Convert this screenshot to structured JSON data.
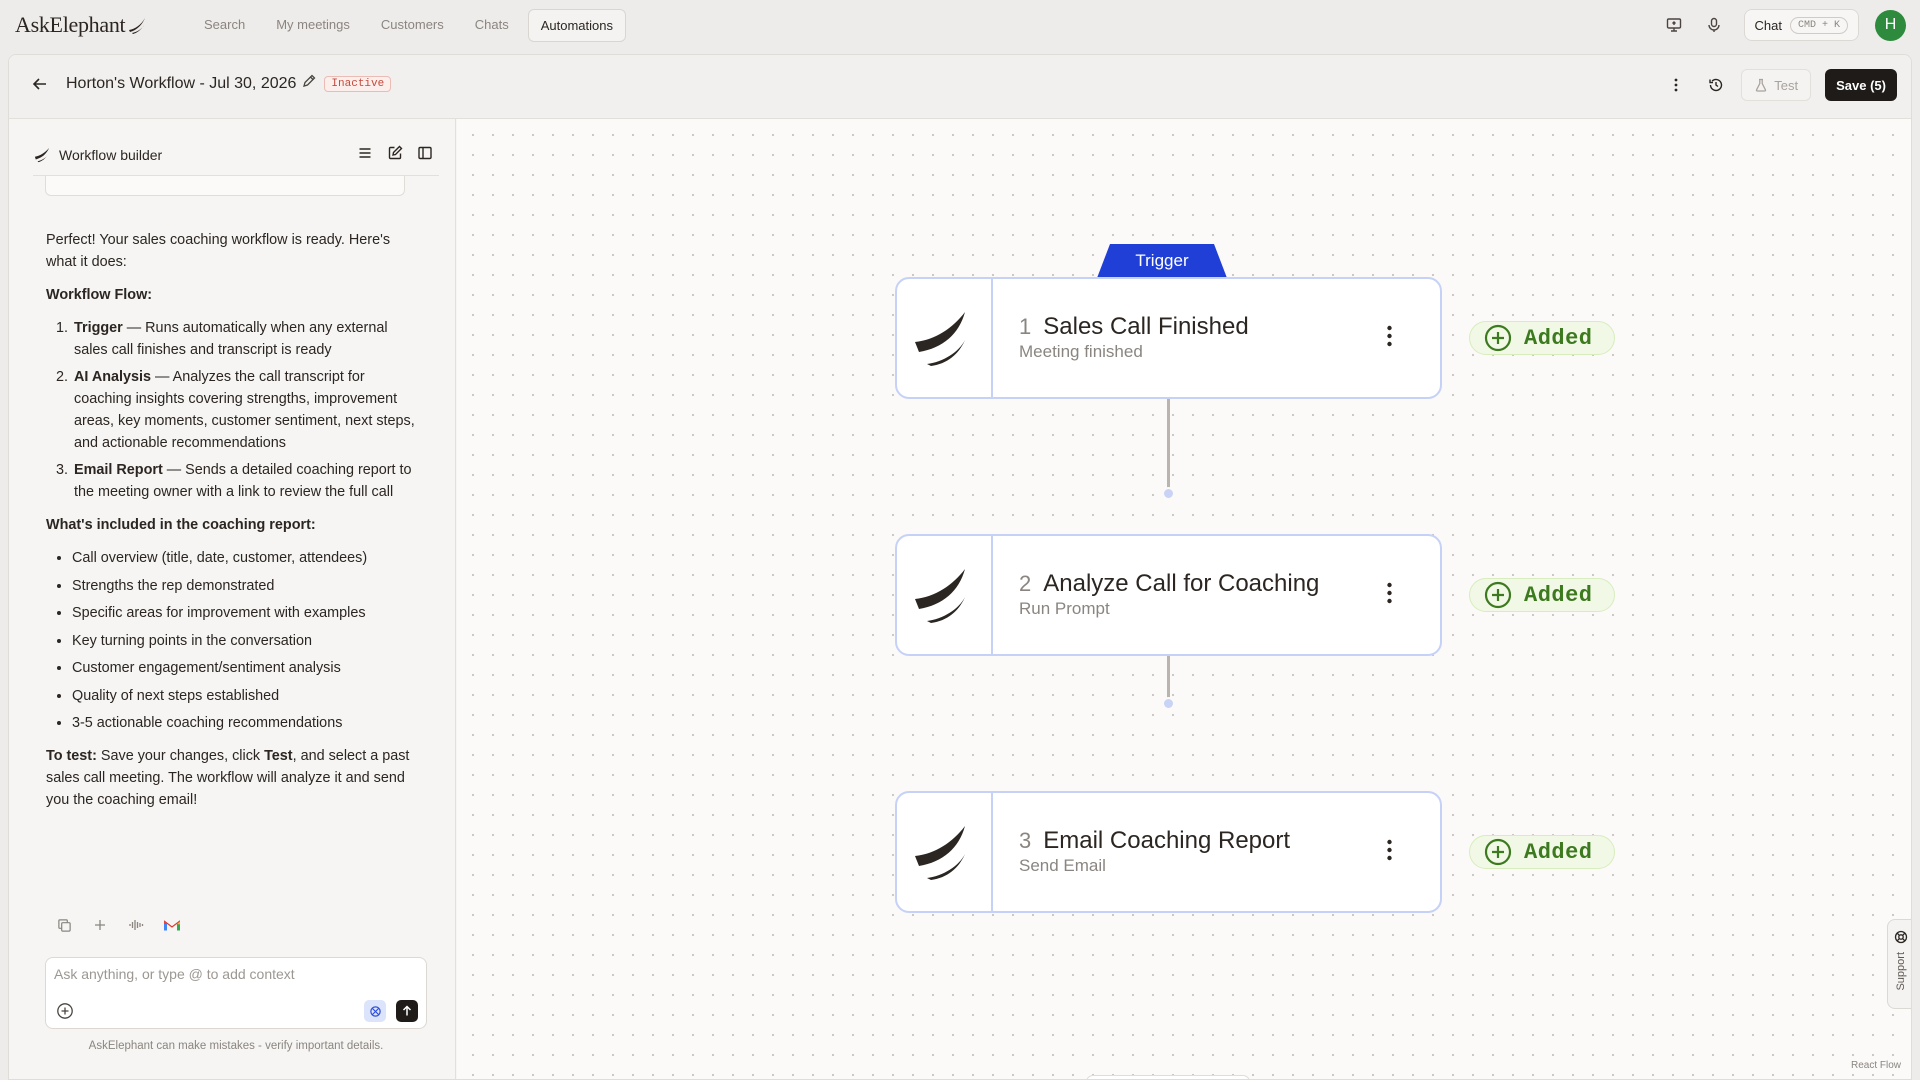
{
  "app": {
    "logo_text": "AskElephant",
    "nav_tabs": [
      {
        "label": "Search"
      },
      {
        "label": "My meetings"
      },
      {
        "label": "Customers"
      },
      {
        "label": "Chats"
      },
      {
        "label": "Automations",
        "active": true
      }
    ],
    "chat_button": {
      "label": "Chat",
      "shortcut": "CMD + K"
    },
    "avatar_initial": "H",
    "avatar_color": "#2e8b3e"
  },
  "header": {
    "title": "Horton's Workflow - Jul 30, 2026",
    "status": "Inactive",
    "test_label": "Test",
    "save_label": "Save (5)"
  },
  "sidebar": {
    "title": "Workflow builder",
    "message": {
      "intro": "Perfect! Your sales coaching workflow is ready. Here's what it does:",
      "flow_heading": "Workflow Flow:",
      "steps": [
        {
          "name": "Trigger",
          "desc": " — Runs automatically when any external sales call finishes and transcript is ready"
        },
        {
          "name": "AI Analysis",
          "desc": " — Analyzes the call transcript for coaching insights covering strengths, improvement areas, key moments, customer sentiment, next steps, and actionable recommendations"
        },
        {
          "name": "Email Report",
          "desc": " — Sends a detailed coaching report to the meeting owner with a link to review the full call"
        }
      ],
      "included_heading": "What's included in the coaching report:",
      "included": [
        "Call overview (title, date, customer, attendees)",
        "Strengths the rep demonstrated",
        "Specific areas for improvement with examples",
        "Key turning points in the conversation",
        "Customer engagement/sentiment analysis",
        "Quality of next steps established",
        "3-5 actionable coaching recommendations"
      ],
      "test_label": "To test:",
      "test_pre": " Save your changes, click ",
      "test_bold": "Test",
      "test_post": ", and select a past sales call meeting. The workflow will analyze it and send you the coaching email!"
    },
    "input_placeholder": "Ask anything, or type @ to add context",
    "disclaimer": "AskElephant can make mistakes - verify important details."
  },
  "canvas": {
    "trigger_label": "Trigger",
    "accent_color": "#1f3fd6",
    "nodes": [
      {
        "num": "1",
        "name": "Sales Call Finished",
        "sub": "Meeting finished",
        "badge": "Added"
      },
      {
        "num": "2",
        "name": "Analyze Call for Coaching",
        "sub": "Run Prompt",
        "badge": "Added"
      },
      {
        "num": "3",
        "name": "Email Coaching Report",
        "sub": "Send Email",
        "badge": "Added"
      }
    ],
    "support_label": "Support",
    "attribution": "React Flow"
  }
}
